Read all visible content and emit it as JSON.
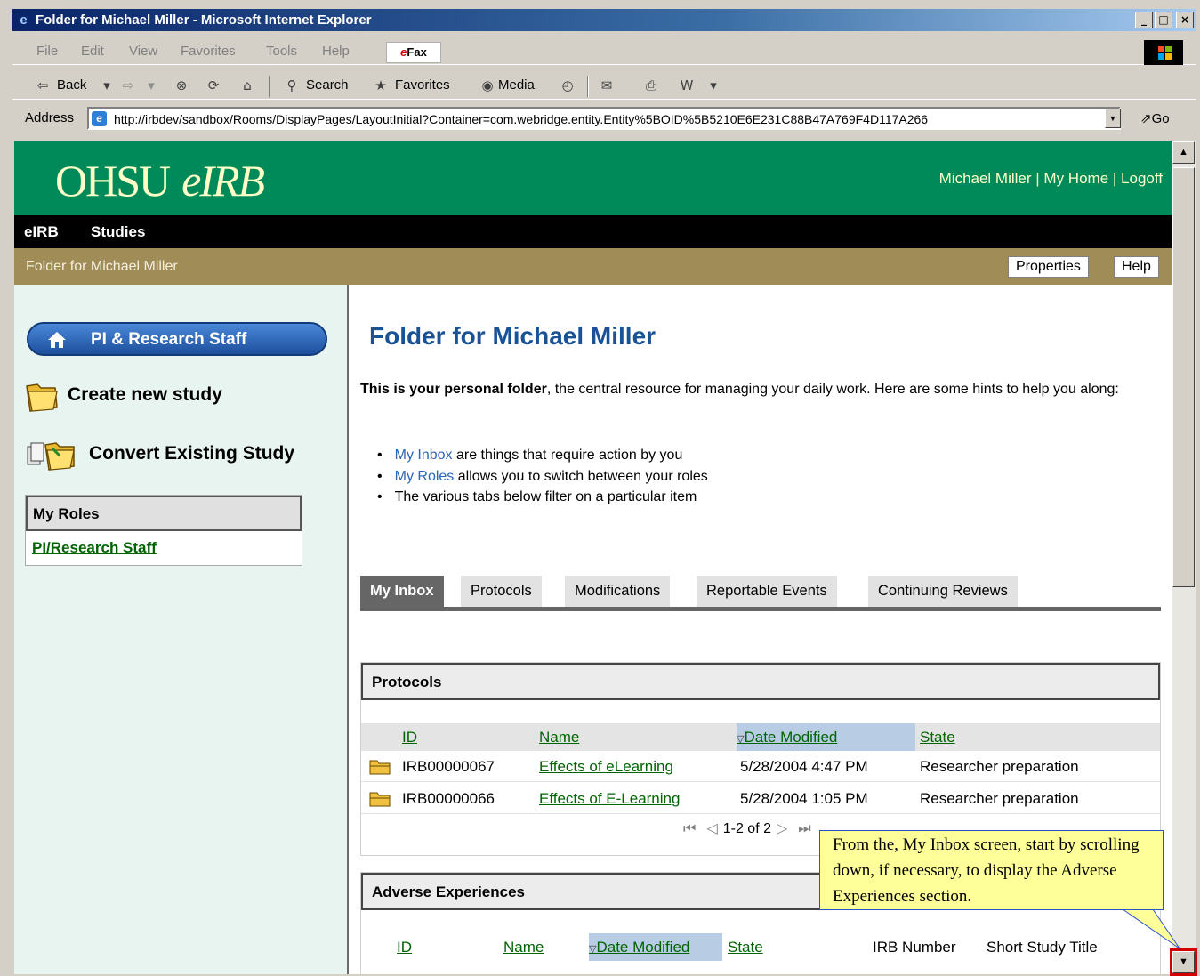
{
  "window": {
    "title": "Folder for Michael Miller - Microsoft Internet Explorer",
    "controls": [
      "_",
      "□",
      "×"
    ]
  },
  "menu": [
    "File",
    "Edit",
    "View",
    "Favorites",
    "Tools",
    "Help"
  ],
  "efax": {
    "prefix": "e",
    "suffix": "Fax"
  },
  "toolbar": {
    "back": "Back",
    "search": "Search",
    "favorites": "Favorites",
    "media": "Media"
  },
  "address": {
    "label": "Address",
    "url": "http://irbdev/sandbox/Rooms/DisplayPages/LayoutInitial?Container=com.webridge.entity.Entity%5BOID%5B5210E6E231C88B47A769F4D117A266",
    "go": "Go"
  },
  "site": {
    "logo_main": "OHSU",
    "logo_sub": "eIRB",
    "user_name": "Michael Miller",
    "sep": " | ",
    "my_home": "My Home",
    "sep2": " |   ",
    "logoff": "Logoff"
  },
  "nav": {
    "eirb": "eIRB",
    "studies": "Studies"
  },
  "crumb": {
    "text": "Folder for Michael Miller",
    "properties": "Properties",
    "help": "Help"
  },
  "sidebar": {
    "pi_button": "PI & Research Staff",
    "create_study": "Create new study",
    "convert_study": "Convert Existing Study",
    "roles_title": "My Roles",
    "roles_link": "PI/Research Staff"
  },
  "main": {
    "title": "Folder for Michael Miller",
    "intro_bold": "This is your personal folder",
    "intro_rest": ", the central resource for managing your daily work. Here are some hints to help you along:",
    "bullets": [
      {
        "link": "My Inbox",
        "text": " are things that require action by you"
      },
      {
        "link": "My Roles",
        "text": " allows you to switch between your roles"
      },
      {
        "link": "",
        "text": "The various tabs below filter on a particular item"
      }
    ]
  },
  "tabs": [
    "My Inbox",
    "Protocols",
    "Modifications",
    "Reportable Events",
    "Continuing Reviews"
  ],
  "protocols": {
    "title": "Protocols",
    "columns": [
      "ID",
      "Name",
      "Date Modified",
      "State"
    ],
    "rows": [
      {
        "id": "IRB00000067",
        "name": "Effects of eLearning",
        "date": "5/28/2004 4:47 PM",
        "state": "Researcher preparation"
      },
      {
        "id": "IRB00000066",
        "name": "Effects of E-Learning",
        "date": "5/28/2004 1:05 PM",
        "state": "Researcher preparation"
      }
    ],
    "pager": "1-2 of 2"
  },
  "adverse": {
    "title": "Adverse Experiences",
    "columns": [
      "ID",
      "Name",
      "Date Modified",
      "State",
      "IRB Number",
      "Short Study Title"
    ]
  },
  "callout": {
    "text": "From the, My Inbox screen, start by scrolling down, if necessary, to display the Adverse Experiences section."
  },
  "colors": {
    "header_green": "#008a5a",
    "crumb_gold": "#a08c56",
    "title_blue": "#1a5296",
    "link_green": "#006400",
    "callout_yellow": "#ffff99",
    "highlight_red": "#d40000"
  }
}
